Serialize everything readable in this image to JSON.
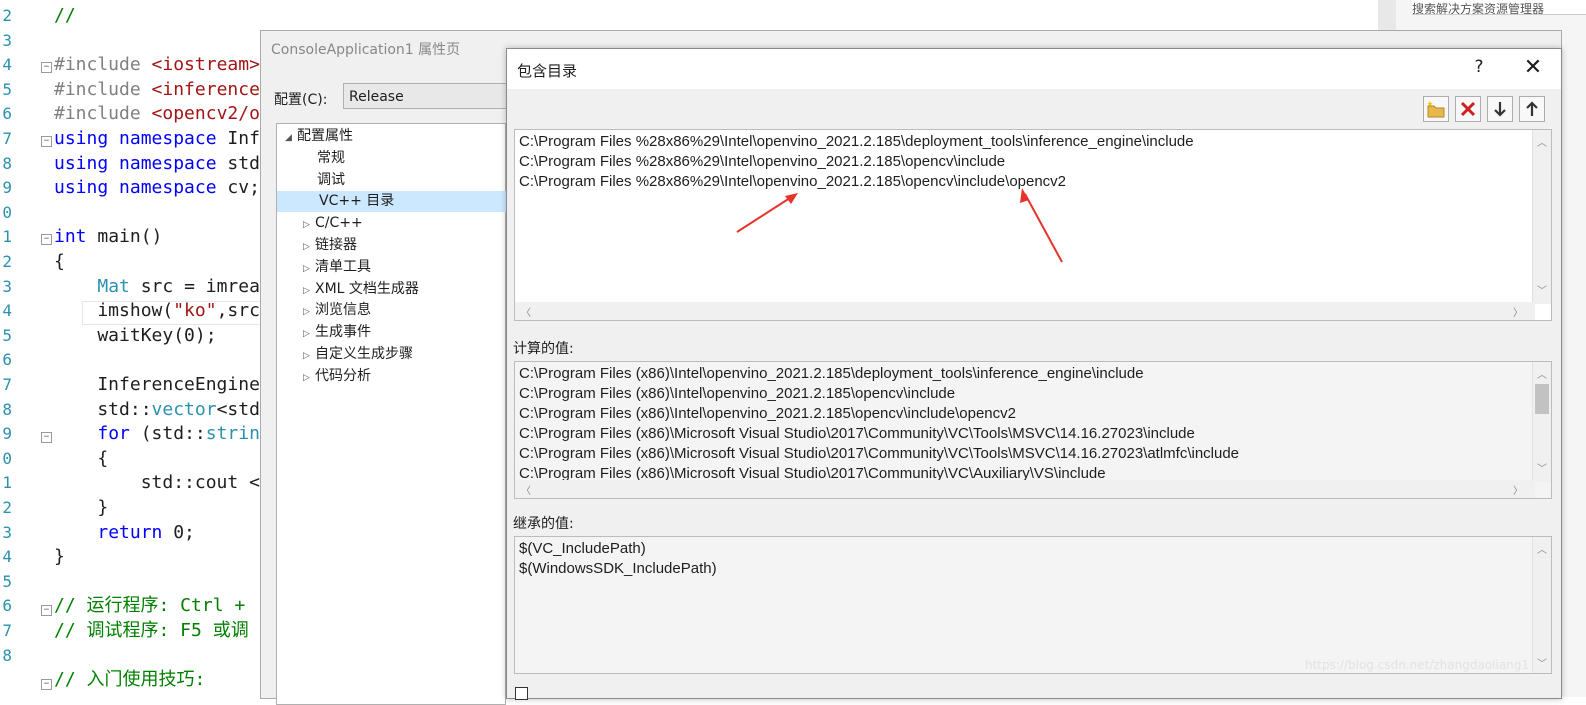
{
  "editor": {
    "line_numbers": [
      "2",
      "3",
      "4",
      "5",
      "6",
      "7",
      "8",
      "9",
      "0",
      "1",
      "2",
      "3",
      "4",
      "5",
      "6",
      "7",
      "8",
      "9",
      "0",
      "1",
      "2",
      "3",
      "4",
      "5",
      "6",
      "7",
      "8"
    ],
    "code_lines": [
      {
        "parts": [
          {
            "t": "//",
            "c": "cm"
          }
        ]
      },
      {
        "parts": []
      },
      {
        "parts": [
          {
            "t": "#include ",
            "c": "pp"
          },
          {
            "t": "<iostream>",
            "c": "inc"
          }
        ]
      },
      {
        "parts": [
          {
            "t": "#include ",
            "c": "pp"
          },
          {
            "t": "<inference",
            "c": "inc"
          }
        ]
      },
      {
        "parts": [
          {
            "t": "#include ",
            "c": "pp"
          },
          {
            "t": "<opencv2/o",
            "c": "inc"
          }
        ]
      },
      {
        "parts": [
          {
            "t": "using namespace ",
            "c": "kw"
          },
          {
            "t": "Inf",
            "c": "fn"
          }
        ]
      },
      {
        "parts": [
          {
            "t": "using namespace ",
            "c": "kw"
          },
          {
            "t": "std",
            "c": "fn"
          }
        ]
      },
      {
        "parts": [
          {
            "t": "using namespace ",
            "c": "kw"
          },
          {
            "t": "cv;",
            "c": "fn"
          }
        ]
      },
      {
        "parts": []
      },
      {
        "parts": [
          {
            "t": "int ",
            "c": "kw"
          },
          {
            "t": "main()",
            "c": "fn"
          }
        ]
      },
      {
        "parts": [
          {
            "t": "{",
            "c": "fn"
          }
        ]
      },
      {
        "parts": [
          {
            "t": "    ",
            "c": "fn"
          },
          {
            "t": "Mat ",
            "c": "type"
          },
          {
            "t": "src = imrea",
            "c": "fn"
          }
        ]
      },
      {
        "parts": [
          {
            "t": "    imshow(",
            "c": "fn"
          },
          {
            "t": "\"ko\"",
            "c": "str"
          },
          {
            "t": ",src",
            "c": "fn"
          }
        ]
      },
      {
        "parts": [
          {
            "t": "    waitKey(0);",
            "c": "fn"
          }
        ]
      },
      {
        "parts": []
      },
      {
        "parts": [
          {
            "t": "    InferenceEngine",
            "c": "fn"
          }
        ]
      },
      {
        "parts": [
          {
            "t": "    std::",
            "c": "fn"
          },
          {
            "t": "vector",
            "c": "type"
          },
          {
            "t": "<std",
            "c": "fn"
          }
        ]
      },
      {
        "parts": [
          {
            "t": "    ",
            "c": "fn"
          },
          {
            "t": "for ",
            "c": "kw"
          },
          {
            "t": "(std::",
            "c": "fn"
          },
          {
            "t": "strin",
            "c": "type"
          }
        ]
      },
      {
        "parts": [
          {
            "t": "    {",
            "c": "fn"
          }
        ]
      },
      {
        "parts": [
          {
            "t": "        std::cout <",
            "c": "fn"
          }
        ]
      },
      {
        "parts": [
          {
            "t": "    }",
            "c": "fn"
          }
        ]
      },
      {
        "parts": [
          {
            "t": "    ",
            "c": "fn"
          },
          {
            "t": "return ",
            "c": "kw"
          },
          {
            "t": "0;",
            "c": "fn"
          }
        ]
      },
      {
        "parts": [
          {
            "t": "}",
            "c": "fn"
          }
        ]
      },
      {
        "parts": []
      },
      {
        "parts": [
          {
            "t": "// 运行程序: Ctrl + ",
            "c": "cm"
          }
        ]
      },
      {
        "parts": [
          {
            "t": "// 调试程序: F5 或调",
            "c": "cm"
          }
        ]
      },
      {
        "parts": []
      },
      {
        "parts": [
          {
            "t": "// 入门使用技巧:",
            "c": "cm"
          }
        ]
      }
    ]
  },
  "right_panel": {
    "search_placeholder": "搜索解决方案资源管理器"
  },
  "property_dialog": {
    "title": "ConsoleApplication1 属性页",
    "config_label": "配置(C):",
    "config_value": "Release",
    "tree": [
      {
        "label": "配置属性",
        "level": 0,
        "expander": "◢",
        "selected": false
      },
      {
        "label": "常规",
        "level": 1,
        "expander": "",
        "selected": false
      },
      {
        "label": "调试",
        "level": 1,
        "expander": "",
        "selected": false
      },
      {
        "label": "VC++ 目录",
        "level": 1,
        "expander": "",
        "selected": true
      },
      {
        "label": "C/C++",
        "level": 1,
        "expander": "▷",
        "selected": false
      },
      {
        "label": "链接器",
        "level": 1,
        "expander": "▷",
        "selected": false
      },
      {
        "label": "清单工具",
        "level": 1,
        "expander": "▷",
        "selected": false
      },
      {
        "label": "XML 文档生成器",
        "level": 1,
        "expander": "▷",
        "selected": false
      },
      {
        "label": "浏览信息",
        "level": 1,
        "expander": "▷",
        "selected": false
      },
      {
        "label": "生成事件",
        "level": 1,
        "expander": "▷",
        "selected": false
      },
      {
        "label": "自定义生成步骤",
        "level": 1,
        "expander": "▷",
        "selected": false
      },
      {
        "label": "代码分析",
        "level": 1,
        "expander": "▷",
        "selected": false
      }
    ]
  },
  "include_dialog": {
    "title": "包含目录",
    "help": "?",
    "close": "✕",
    "toolbar": {
      "new_folder": "new-folder-icon",
      "delete": "delete-icon",
      "move_down": "move-down-icon",
      "move_up": "move-up-icon"
    },
    "entries": [
      "C:\\Program Files %28x86%29\\Intel\\openvino_2021.2.185\\deployment_tools\\inference_engine\\include",
      "C:\\Program Files %28x86%29\\Intel\\openvino_2021.2.185\\opencv\\include",
      "C:\\Program Files %28x86%29\\Intel\\openvino_2021.2.185\\opencv\\include\\opencv2"
    ],
    "computed_label": "计算的值:",
    "computed": [
      "C:\\Program Files (x86)\\Intel\\openvino_2021.2.185\\deployment_tools\\inference_engine\\include",
      "C:\\Program Files (x86)\\Intel\\openvino_2021.2.185\\opencv\\include",
      "C:\\Program Files (x86)\\Intel\\openvino_2021.2.185\\opencv\\include\\opencv2",
      "C:\\Program Files (x86)\\Microsoft Visual Studio\\2017\\Community\\VC\\Tools\\MSVC\\14.16.27023\\include",
      "C:\\Program Files (x86)\\Microsoft Visual Studio\\2017\\Community\\VC\\Tools\\MSVC\\14.16.27023\\atlmfc\\include",
      "C:\\Program Files (x86)\\Microsoft Visual Studio\\2017\\Community\\VC\\Auxiliary\\VS\\include"
    ],
    "inherited_label": "继承的值:",
    "inherited": [
      "$(VC_IncludePath)",
      "$(WindowsSDK_IncludePath)"
    ],
    "annotation_color": "#e8322b"
  },
  "watermark": "https://blog.csdn.net/zhangdaoliang1"
}
